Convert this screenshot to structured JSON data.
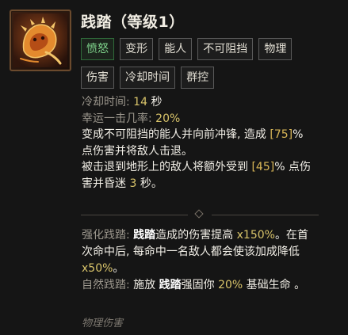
{
  "skill": {
    "title": "践踏（等级1）",
    "icon": "bear-paw-icon"
  },
  "tags": [
    "愤怒",
    "变形",
    "能人",
    "不可阻挡",
    "物理",
    "伤害",
    "冷却时间",
    "群控"
  ],
  "stats": {
    "cooldown_label": "冷却时间:",
    "cooldown_value": "14",
    "cooldown_unit": "秒",
    "lucky_label": "幸运一击几率:",
    "lucky_value": "20%"
  },
  "description": {
    "line1_pre": "变成不可阻挡的能人并向前冲锋, 造成",
    "line1_bracket": "[75]",
    "line1_post": "%",
    "line2": "点伤害并将敌人击退。",
    "line3_pre": "被击退到地形上的敌人将额外受到",
    "line3_bracket": "[45]",
    "line3_post": "% 点伤",
    "line4_pre": "害并昏迷",
    "line4_value": "3",
    "line4_post": "秒。"
  },
  "enhancements": {
    "e1_label": "强化践踏:",
    "e1_skill": "践踏",
    "e1_text1": "造成的伤害提高",
    "e1_value1": "x150%",
    "e1_text2": "。在首",
    "e1_line2": "次命中后, 每命中一名敌人都会使该加成降低",
    "e1_value2": "x50%",
    "e1_end": "。",
    "e2_label": "自然践踏:",
    "e2_text1": "施放",
    "e2_skill": "践踏",
    "e2_text2": "强固你",
    "e2_value": "20%",
    "e2_text3": "基础生命 。"
  },
  "footer": "物理伤害",
  "colors": {
    "background": "#151515",
    "active_tag": "#7fd48c",
    "highlight": "#d9c46a",
    "icon_accent": "#e07a2a"
  }
}
